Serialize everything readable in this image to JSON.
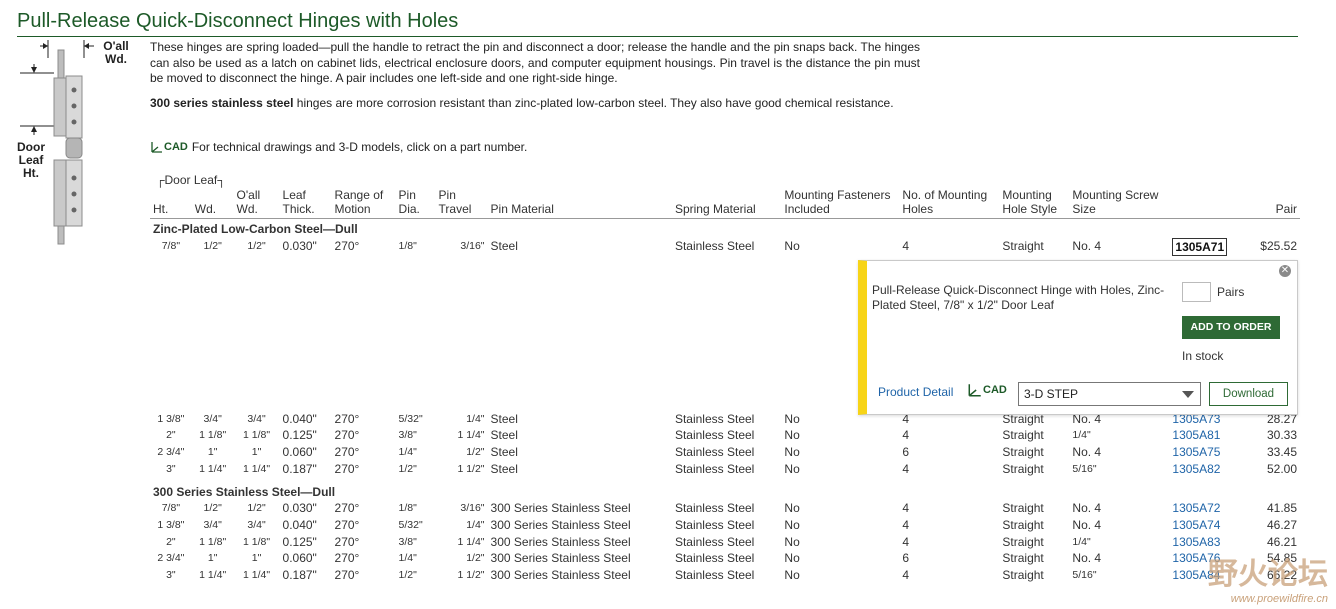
{
  "page": {
    "title": "Pull-Release Quick-Disconnect Hinges with Holes",
    "description1": "These hinges are spring loaded—pull the handle to retract the pin and disconnect a door; release the handle and the pin snaps back. The hinges can also be used as a latch on cabinet lids, electrical enclosure doors, and computer equipment housings. Pin travel is the distance the pin must be moved to disconnect the hinge. A pair includes one left-side and one right-side hinge.",
    "description2_bold": "300 series stainless steel",
    "description2_rest": " hinges are more corrosion resistant than zinc-plated low-carbon steel. They also have good chemical resistance.",
    "cad_note": "For technical drawings and 3-D models, click on a part number.",
    "cad_icon_text": "CAD"
  },
  "figure": {
    "oall_label": "O'all Wd.",
    "door_leaf_label": "Door Leaf Ht."
  },
  "table": {
    "door_leaf_group": "Door Leaf",
    "headers": {
      "ht": "Ht.",
      "wd": "Wd.",
      "oall_wd": "O'all Wd.",
      "leaf_thick": "Leaf Thick.",
      "range_of_motion": "Range of Motion",
      "pin_dia": "Pin Dia.",
      "pin_travel": "Pin Travel",
      "pin_material": "Pin Material",
      "spring_material": "Spring Material",
      "mounting_fasteners": "Mounting Fasteners Included",
      "no_mounting_holes": "No. of Mounting Holes",
      "mounting_hole_style": "Mounting Hole Style",
      "mounting_screw_size": "Mounting Screw Size",
      "part": "",
      "pair": "Pair"
    },
    "group1_label": "Zinc-Plated Low-Carbon Steel—Dull",
    "group1_first": {
      "ht": "7/8\"",
      "wd": "1/2\"",
      "oall": "1/2\"",
      "thick": "0.030\"",
      "motion": "270°",
      "dia": "1/8\"",
      "travel": "3/16\"",
      "pin_mat": "Steel",
      "spring": "Stainless Steel",
      "fasteners": "No",
      "holes": "4",
      "style": "Straight",
      "screw": "No. 4",
      "part": "1305A71",
      "price": "$25.52"
    },
    "group1_rest": [
      {
        "ht": "1 3/8\"",
        "wd": "3/4\"",
        "oall": "3/4\"",
        "thick": "0.040\"",
        "motion": "270°",
        "dia": "5/32\"",
        "travel": "1/4\"",
        "pin_mat": "Steel",
        "spring": "Stainless Steel",
        "fasteners": "No",
        "holes": "4",
        "style": "Straight",
        "screw": "No. 4",
        "part": "1305A73",
        "price": "28.27"
      },
      {
        "ht": "2\"",
        "wd": "1 1/8\"",
        "oall": "1 1/8\"",
        "thick": "0.125\"",
        "motion": "270°",
        "dia": "3/8\"",
        "travel": "1 1/4\"",
        "pin_mat": "Steel",
        "spring": "Stainless Steel",
        "fasteners": "No",
        "holes": "4",
        "style": "Straight",
        "screw": "1/4\"",
        "part": "1305A81",
        "price": "30.33"
      },
      {
        "ht": "2 3/4\"",
        "wd": "1\"",
        "oall": "1\"",
        "thick": "0.060\"",
        "motion": "270°",
        "dia": "1/4\"",
        "travel": "1/2\"",
        "pin_mat": "Steel",
        "spring": "Stainless Steel",
        "fasteners": "No",
        "holes": "6",
        "style": "Straight",
        "screw": "No. 4",
        "part": "1305A75",
        "price": "33.45"
      },
      {
        "ht": "3\"",
        "wd": "1 1/4\"",
        "oall": "1 1/4\"",
        "thick": "0.187\"",
        "motion": "270°",
        "dia": "1/2\"",
        "travel": "1 1/2\"",
        "pin_mat": "Steel",
        "spring": "Stainless Steel",
        "fasteners": "No",
        "holes": "4",
        "style": "Straight",
        "screw": "5/16\"",
        "part": "1305A82",
        "price": "52.00"
      }
    ],
    "group2_label": "300 Series Stainless Steel—Dull",
    "group2": [
      {
        "ht": "7/8\"",
        "wd": "1/2\"",
        "oall": "1/2\"",
        "thick": "0.030\"",
        "motion": "270°",
        "dia": "1/8\"",
        "travel": "3/16\"",
        "pin_mat": "300 Series Stainless Steel",
        "spring": "Stainless Steel",
        "fasteners": "No",
        "holes": "4",
        "style": "Straight",
        "screw": "No. 4",
        "part": "1305A72",
        "price": "41.85"
      },
      {
        "ht": "1 3/8\"",
        "wd": "3/4\"",
        "oall": "3/4\"",
        "thick": "0.040\"",
        "motion": "270°",
        "dia": "5/32\"",
        "travel": "1/4\"",
        "pin_mat": "300 Series Stainless Steel",
        "spring": "Stainless Steel",
        "fasteners": "No",
        "holes": "4",
        "style": "Straight",
        "screw": "No. 4",
        "part": "1305A74",
        "price": "46.27"
      },
      {
        "ht": "2\"",
        "wd": "1 1/8\"",
        "oall": "1 1/8\"",
        "thick": "0.125\"",
        "motion": "270°",
        "dia": "3/8\"",
        "travel": "1 1/4\"",
        "pin_mat": "300 Series Stainless Steel",
        "spring": "Stainless Steel",
        "fasteners": "No",
        "holes": "4",
        "style": "Straight",
        "screw": "1/4\"",
        "part": "1305A83",
        "price": "46.21"
      },
      {
        "ht": "2 3/4\"",
        "wd": "1\"",
        "oall": "1\"",
        "thick": "0.060\"",
        "motion": "270°",
        "dia": "1/4\"",
        "travel": "1/2\"",
        "pin_mat": "300 Series Stainless Steel",
        "spring": "Stainless Steel",
        "fasteners": "No",
        "holes": "6",
        "style": "Straight",
        "screw": "No. 4",
        "part": "1305A76",
        "price": "54.85"
      },
      {
        "ht": "3\"",
        "wd": "1 1/4\"",
        "oall": "1 1/4\"",
        "thick": "0.187\"",
        "motion": "270°",
        "dia": "1/2\"",
        "travel": "1 1/2\"",
        "pin_mat": "300 Series Stainless Steel",
        "spring": "Stainless Steel",
        "fasteners": "No",
        "holes": "4",
        "style": "Straight",
        "screw": "5/16\"",
        "part": "1305A84",
        "price": "66.22"
      }
    ]
  },
  "popup": {
    "description": "Pull-Release Quick-Disconnect Hinge with Holes, Zinc-Plated Steel, 7/8\" x 1/2\" Door Leaf",
    "qty_value": "",
    "qty_unit": "Pairs",
    "add_to_order": "ADD TO ORDER",
    "stock": "In stock",
    "product_detail": "Product Detail",
    "cad_icon_text": "CAD",
    "format_selected": "3-D STEP",
    "download": "Download"
  },
  "watermark": {
    "logo_text": "野火论坛",
    "url": "www.proewildfire.cn"
  },
  "colors": {
    "brand_green": "#1d5a28",
    "button_green": "#2e6a35",
    "link_blue": "#1f64a8",
    "popup_accent": "#f7d417"
  }
}
